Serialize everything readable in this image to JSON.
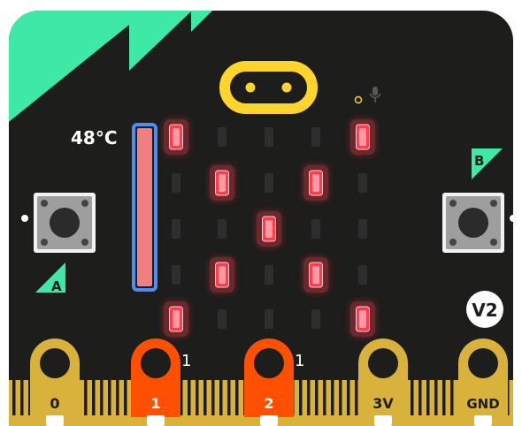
{
  "board": {
    "name": "micro:bit",
    "version_badge": "V2",
    "body_color": "#1d1d1b",
    "accent_color": "#3ee8a6",
    "logo_color": "#ffd52b",
    "gold_color": "#d8b23b",
    "active_pin_color": "#ff4f00"
  },
  "temperature": {
    "label": "48°C",
    "value_c": 48,
    "fill_fraction": 1.0,
    "outline_color": "#4f8ef0",
    "fill_color": "#f08080"
  },
  "buttons": {
    "a_label": "A",
    "b_label": "B"
  },
  "led_matrix": {
    "on_color": "#ff3c4b",
    "off_color": "#2e2e2e",
    "rows": [
      [
        1,
        0,
        0,
        0,
        1
      ],
      [
        0,
        1,
        0,
        1,
        0
      ],
      [
        0,
        0,
        1,
        0,
        0
      ],
      [
        0,
        1,
        0,
        1,
        0
      ],
      [
        1,
        0,
        0,
        0,
        1
      ]
    ]
  },
  "pins": [
    {
      "label": "0",
      "active": false,
      "value": ""
    },
    {
      "label": "1",
      "active": true,
      "value": "1"
    },
    {
      "label": "2",
      "active": true,
      "value": "1"
    },
    {
      "label": "3V",
      "active": false,
      "value": ""
    },
    {
      "label": "GND",
      "active": false,
      "value": ""
    }
  ],
  "icons": {
    "logo": "touch-logo-icon",
    "microphone": "microphone-icon"
  }
}
